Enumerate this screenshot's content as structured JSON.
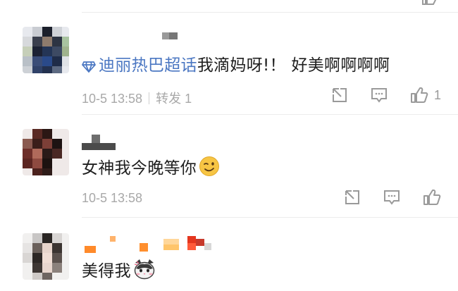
{
  "comments": [
    {
      "topic": "迪丽热巴超话",
      "text": "我滴妈呀!！ 好美啊啊啊啊",
      "time": "10-5 13:58",
      "repost_label": "转发 1",
      "like_count": "1"
    },
    {
      "text": "女神我今晚等你",
      "emoji": "winking-face",
      "time": "10-5 13:58",
      "like_count": ""
    },
    {
      "text": "美得我",
      "emoji": "cat-face"
    }
  ],
  "colors": {
    "topic_link": "#4b77c2",
    "meta_text": "#a8a8a8",
    "icon_gray": "#9a9a9a",
    "divider": "#ececec"
  },
  "icons": [
    "share-icon",
    "comment-icon",
    "like-icon",
    "topic-icon"
  ]
}
